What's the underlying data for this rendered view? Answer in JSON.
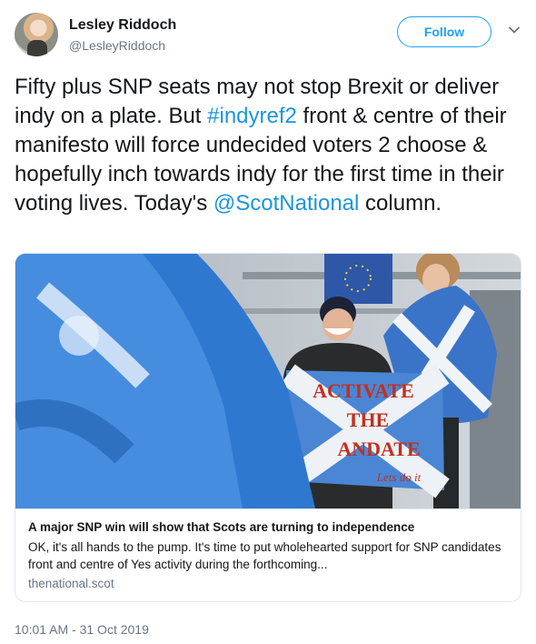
{
  "author": {
    "name": "Lesley Riddoch",
    "handle": "@LesleyRiddoch",
    "avatar_icon": "profile-photo"
  },
  "follow_label": "Follow",
  "caret_icon": "chevron-down-icon",
  "tweet": {
    "part1": "Fifty plus SNP seats may not stop Brexit or deliver indy on a plate. But ",
    "hashtag": "#indyref2",
    "part2": " front & centre of their manifesto will force undecided voters 2 choose & hopefully inch towards indy for the first time in their voting lives. Today's ",
    "mention": "@ScotNational",
    "part3": " column."
  },
  "card": {
    "banner": {
      "line1": "ACTIVATE",
      "line2": "THE",
      "line3": "ANDATE",
      "line4": "Lets do it"
    },
    "title": "A major SNP win will show that Scots are turning to independence",
    "description": "OK, it's all hands to the pump. It's time to put wholehearted support for SNP candidates front and centre of Yes activity during the forthcoming...",
    "domain": "thenational.scot"
  },
  "timestamp": "10:01 AM - 31 Oct 2019",
  "colors": {
    "link": "#1b95e0",
    "follow": "#1da1f2",
    "muted": "#657786"
  }
}
